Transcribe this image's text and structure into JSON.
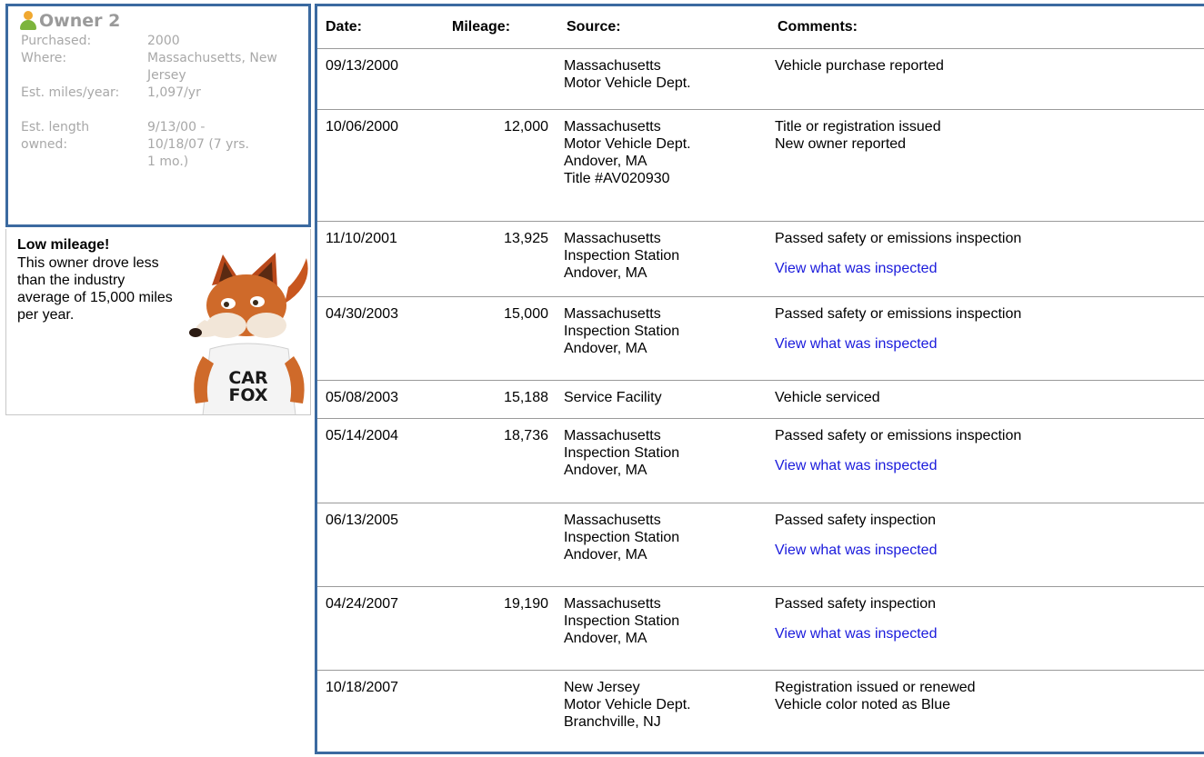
{
  "owner": {
    "title": "Owner 2",
    "fields": [
      {
        "label": "Purchased:",
        "value": "2000"
      },
      {
        "label": "Where:",
        "value": "Massachusetts, New Jersey"
      },
      {
        "label": "Est. miles/year:",
        "value": "1,097/yr"
      },
      {
        "label": "Est. length owned:",
        "value": "9/13/00 - 10/18/07 (7 yrs. 1 mo.)"
      }
    ]
  },
  "low_mileage": {
    "title": "Low mileage!",
    "text": "This owner drove less than the industry average of 15,000 miles per year.",
    "mascot_shirt": "CAR FOX"
  },
  "table": {
    "headers": {
      "date": "Date:",
      "mileage": "Mileage:",
      "source": "Source:",
      "comments": "Comments:"
    },
    "link_label": "View what was inspected",
    "rows": [
      {
        "date": "09/13/2000",
        "mileage": "",
        "source": [
          "Massachusetts",
          "Motor Vehicle Dept."
        ],
        "comments": [
          "Vehicle purchase reported"
        ],
        "link": false
      },
      {
        "date": "10/06/2000",
        "mileage": "12,000",
        "source": [
          "Massachusetts",
          "Motor Vehicle Dept.",
          "Andover, MA",
          "Title #AV020930"
        ],
        "comments": [
          "Title or registration issued",
          "New owner reported"
        ],
        "link": false
      },
      {
        "date": "11/10/2001",
        "mileage": "13,925",
        "source": [
          "Massachusetts",
          "Inspection Station",
          "Andover, MA"
        ],
        "comments": [
          "Passed safety or emissions inspection"
        ],
        "link": true
      },
      {
        "date": "04/30/2003",
        "mileage": "15,000",
        "source": [
          "Massachusetts",
          "Inspection Station",
          "Andover, MA"
        ],
        "comments": [
          "Passed safety or emissions inspection"
        ],
        "link": true
      },
      {
        "date": "05/08/2003",
        "mileage": "15,188",
        "source": [
          "Service Facility"
        ],
        "comments": [
          "Vehicle serviced"
        ],
        "link": false
      },
      {
        "date": "05/14/2004",
        "mileage": "18,736",
        "source": [
          "Massachusetts",
          "Inspection Station",
          "Andover, MA"
        ],
        "comments": [
          "Passed safety or emissions inspection"
        ],
        "link": true
      },
      {
        "date": "06/13/2005",
        "mileage": "",
        "source": [
          "Massachusetts",
          "Inspection Station",
          "Andover, MA"
        ],
        "comments": [
          "Passed safety inspection"
        ],
        "link": true
      },
      {
        "date": "04/24/2007",
        "mileage": "19,190",
        "source": [
          "Massachusetts",
          "Inspection Station",
          "Andover, MA"
        ],
        "comments": [
          "Passed safety inspection"
        ],
        "link": true
      },
      {
        "date": "10/18/2007",
        "mileage": "",
        "source": [
          "New Jersey",
          "Motor Vehicle Dept.",
          "Branchville, NJ"
        ],
        "comments": [
          "Registration issued or renewed",
          "Vehicle color noted as Blue"
        ],
        "link": false
      }
    ]
  },
  "colors": {
    "border": "#3b6aa0",
    "link": "#1a1adc",
    "muted_text": "#a8a8a8"
  }
}
